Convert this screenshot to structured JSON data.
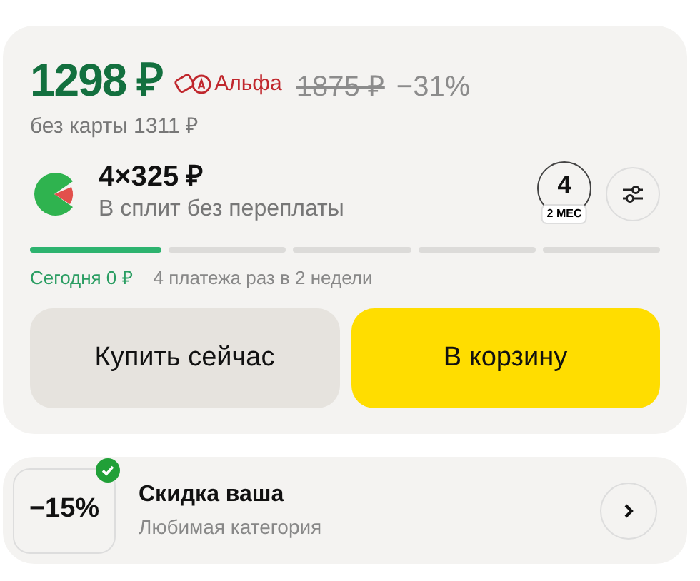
{
  "price": {
    "current": "1298 ₽",
    "bank_label": "Альфа",
    "old": "1875 ₽",
    "discount": "−31%",
    "without_card": "без карты 1311 ₽"
  },
  "split": {
    "amount": "4×325 ₽",
    "caption": "В сплит без переплаты",
    "payments_count": "4",
    "period": "2 МЕС",
    "segments": [
      {
        "filled": true
      },
      {
        "filled": false
      },
      {
        "filled": false
      },
      {
        "filled": false
      },
      {
        "filled": false
      }
    ],
    "today": "Сегодня 0 ₽",
    "schedule": "4 платежа раз в 2 недели"
  },
  "buttons": [
    {
      "label": "Купить сейчас",
      "kind": "secondary"
    },
    {
      "label": "В корзину",
      "kind": "primary"
    }
  ],
  "promo": {
    "badge": "−15%",
    "checked": true,
    "title": "Скидка ваша",
    "subtitle": "Любимая категория"
  }
}
